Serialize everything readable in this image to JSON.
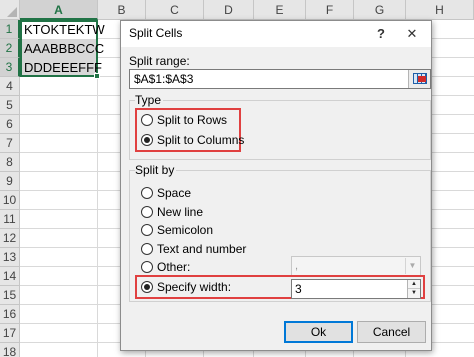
{
  "spreadsheet": {
    "columns": [
      "A",
      "B",
      "C",
      "D",
      "E",
      "F",
      "G",
      "H"
    ],
    "rows": [
      "1",
      "2",
      "3",
      "4",
      "5",
      "6",
      "7",
      "8",
      "9",
      "10",
      "11",
      "12",
      "13",
      "14",
      "15",
      "16",
      "17",
      "18"
    ],
    "cells": [
      "KTOKTEKTW",
      "AAABBBCCC",
      "DDDEEEFFF"
    ]
  },
  "dialog": {
    "title": "Split Cells",
    "help_icon": "question-mark-icon",
    "close_icon": "close-icon",
    "split_range": {
      "label": "Split range:",
      "value": "$A$1:$A$3",
      "button_icon": "range-select-icon"
    },
    "type": {
      "label": "Type",
      "options": [
        {
          "label": "Split to Rows",
          "checked": false
        },
        {
          "label": "Split to Columns",
          "checked": true
        }
      ]
    },
    "split_by": {
      "label": "Split by",
      "options": [
        {
          "label": "Space",
          "checked": false
        },
        {
          "label": "New line",
          "checked": false
        },
        {
          "label": "Semicolon",
          "checked": false
        },
        {
          "label": "Text and number",
          "checked": false
        },
        {
          "label": "Other:",
          "checked": false
        },
        {
          "label": "Specify width:",
          "checked": true
        }
      ],
      "other_value": ",",
      "width_value": "3"
    },
    "buttons": {
      "ok": "Ok",
      "cancel": "Cancel"
    }
  },
  "colors": {
    "excel_green": "#217346",
    "highlight_red": "#e04040",
    "dialog_bg": "#f0f0f0"
  }
}
